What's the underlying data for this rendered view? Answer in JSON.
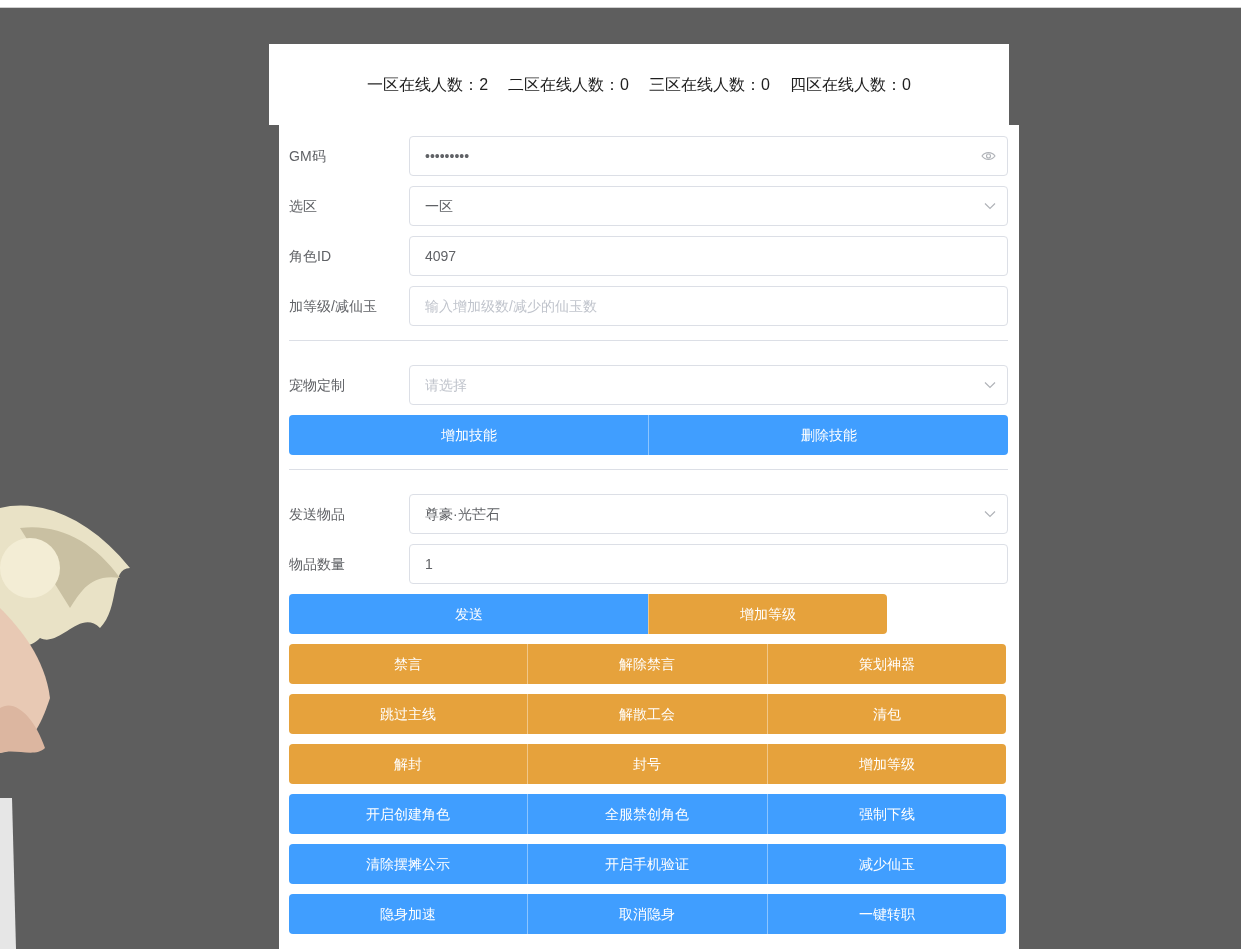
{
  "header": {
    "stats": [
      "一区在线人数：2",
      "二区在线人数：0",
      "三区在线人数：0",
      "四区在线人数：0"
    ]
  },
  "form": {
    "items": [
      {
        "kind": "password",
        "label": "GM码",
        "value": "•••••••••"
      },
      {
        "kind": "select",
        "label": "选区",
        "value": "一区"
      },
      {
        "kind": "text",
        "label": "角色ID",
        "value": "4097"
      },
      {
        "kind": "text",
        "label": "加等级/减仙玉",
        "placeholder": "输入增加级数/减少的仙玉数"
      },
      {
        "kind": "divider"
      },
      {
        "kind": "select",
        "label": "宠物定制",
        "placeholder": "请选择"
      },
      {
        "kind": "split",
        "buttons": [
          {
            "label": "增加技能",
            "kind": "primary"
          },
          {
            "label": "删除技能",
            "kind": "primary"
          }
        ]
      },
      {
        "kind": "divider"
      },
      {
        "kind": "select",
        "label": "发送物品",
        "value": "尊豪·光芒石"
      },
      {
        "kind": "text",
        "label": "物品数量",
        "value": "1"
      },
      {
        "kind": "send",
        "buttons": [
          {
            "label": "发送",
            "kind": "primary"
          },
          {
            "label": "增加等级",
            "kind": "warning"
          }
        ]
      },
      {
        "kind": "grid",
        "buttons": [
          {
            "label": "禁言",
            "kind": "warning"
          },
          {
            "label": "解除禁言",
            "kind": "warning"
          },
          {
            "label": "策划神器",
            "kind": "warning"
          }
        ]
      },
      {
        "kind": "grid",
        "buttons": [
          {
            "label": "跳过主线",
            "kind": "warning"
          },
          {
            "label": "解散工会",
            "kind": "warning"
          },
          {
            "label": "清包",
            "kind": "warning"
          }
        ]
      },
      {
        "kind": "grid",
        "buttons": [
          {
            "label": "解封",
            "kind": "warning"
          },
          {
            "label": "封号",
            "kind": "warning"
          },
          {
            "label": "增加等级",
            "kind": "warning"
          }
        ]
      },
      {
        "kind": "grid",
        "buttons": [
          {
            "label": "开启创建角色",
            "kind": "primary"
          },
          {
            "label": "全服禁创角色",
            "kind": "primary"
          },
          {
            "label": "强制下线",
            "kind": "primary"
          }
        ]
      },
      {
        "kind": "grid",
        "buttons": [
          {
            "label": "清除摆摊公示",
            "kind": "primary"
          },
          {
            "label": "开启手机验证",
            "kind": "primary"
          },
          {
            "label": "减少仙玉",
            "kind": "primary"
          }
        ]
      },
      {
        "kind": "grid",
        "buttons": [
          {
            "label": "隐身加速",
            "kind": "primary"
          },
          {
            "label": "取消隐身",
            "kind": "primary"
          },
          {
            "label": "一键转职",
            "kind": "primary"
          }
        ]
      }
    ]
  }
}
